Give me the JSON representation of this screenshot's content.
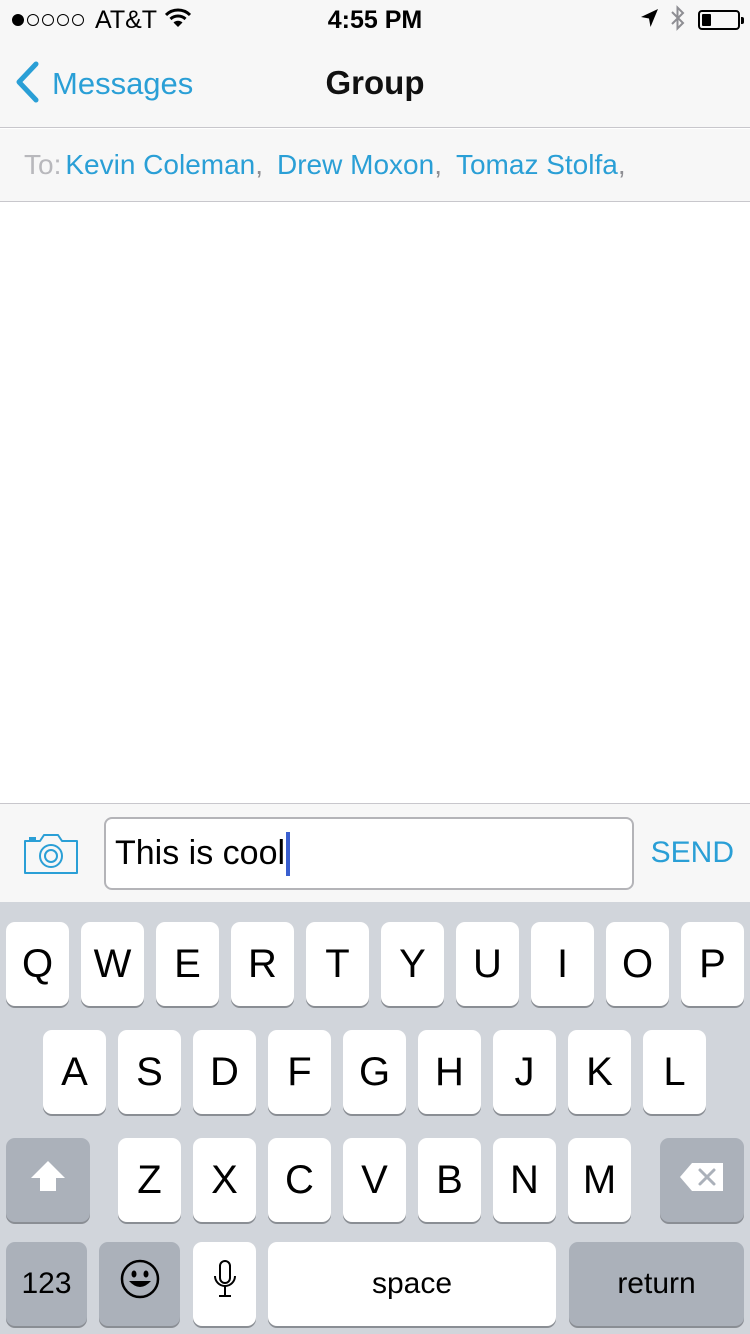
{
  "status_bar": {
    "signal_bars_filled": 1,
    "signal_bars_total": 5,
    "carrier": "AT&T",
    "time": "4:55 PM",
    "icons": [
      "wifi-icon",
      "location-arrow-icon",
      "bluetooth-icon",
      "battery-icon"
    ],
    "battery_level": 0.2
  },
  "nav": {
    "back_label": "Messages",
    "title": "Group"
  },
  "to_field": {
    "label": "To:",
    "recipients": [
      "Kevin Coleman",
      "Drew Moxon",
      "Tomaz Stolfa"
    ]
  },
  "compose": {
    "input_value": "This is cool",
    "send_label": "SEND",
    "camera_icon": "camera-icon"
  },
  "keyboard": {
    "row1": [
      "Q",
      "W",
      "E",
      "R",
      "T",
      "Y",
      "U",
      "I",
      "O",
      "P"
    ],
    "row2": [
      "A",
      "S",
      "D",
      "F",
      "G",
      "H",
      "J",
      "K",
      "L"
    ],
    "row3": [
      "Z",
      "X",
      "C",
      "V",
      "B",
      "N",
      "M"
    ],
    "numbers_label": "123",
    "space_label": "space",
    "return_label": "return",
    "icons": [
      "shift-icon",
      "delete-icon",
      "emoji-icon",
      "microphone-icon"
    ]
  },
  "colors": {
    "accent": "#2a9fd6",
    "bar_background": "#f7f7f7",
    "keyboard_background": "#d1d5db",
    "dark_key": "#abb1ba",
    "caret": "#3a5fcf"
  }
}
